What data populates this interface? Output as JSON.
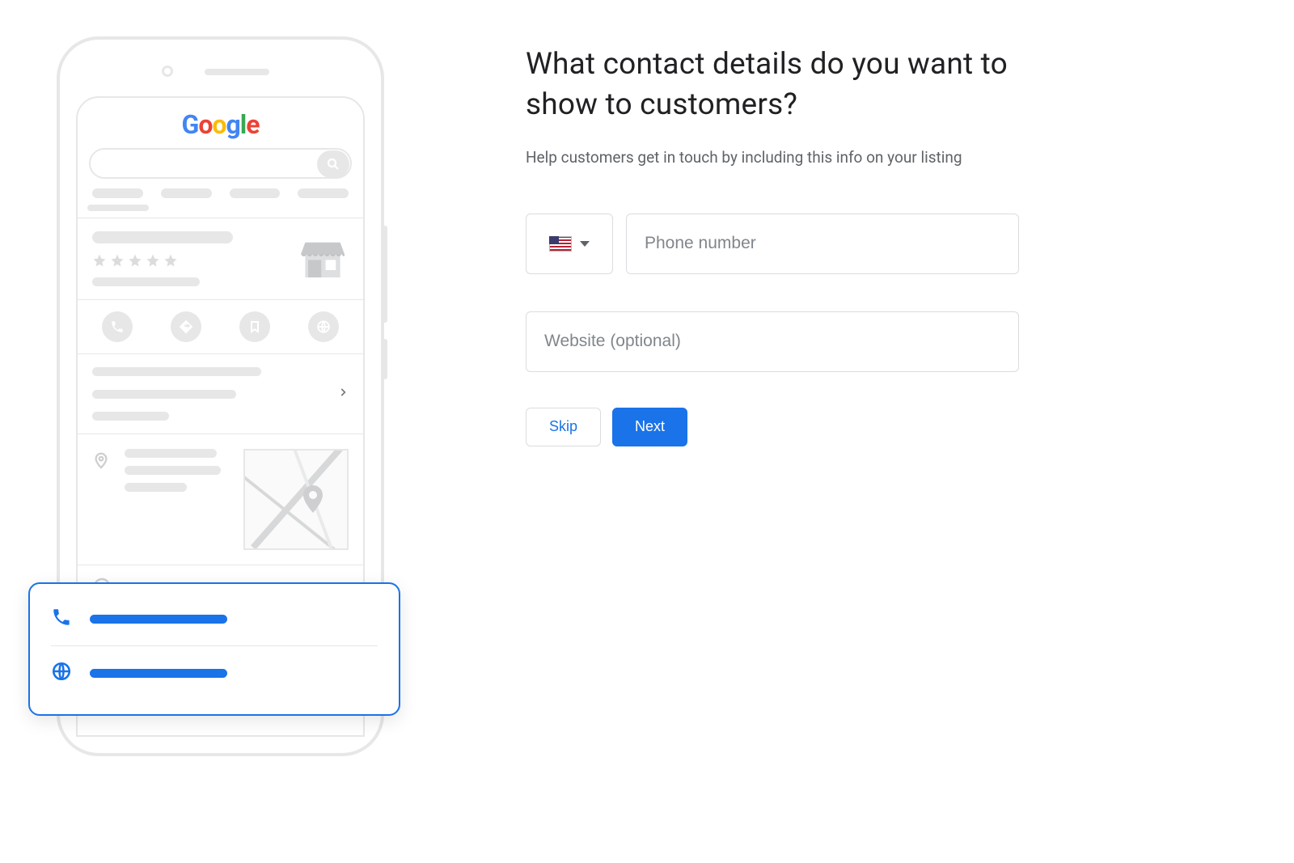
{
  "logo": {
    "letters": [
      "G",
      "o",
      "o",
      "g",
      "l",
      "e"
    ]
  },
  "form": {
    "heading": "What contact details do you want to show to customers?",
    "subheading": "Help customers get in touch by including this info on your listing",
    "country_code": {
      "flag": "US"
    },
    "phone_placeholder": "Phone number",
    "website_placeholder": "Website (optional)",
    "skip_label": "Skip",
    "next_label": "Next"
  },
  "callout": {
    "rows": [
      {
        "icon": "phone-icon"
      },
      {
        "icon": "globe-icon"
      }
    ]
  }
}
